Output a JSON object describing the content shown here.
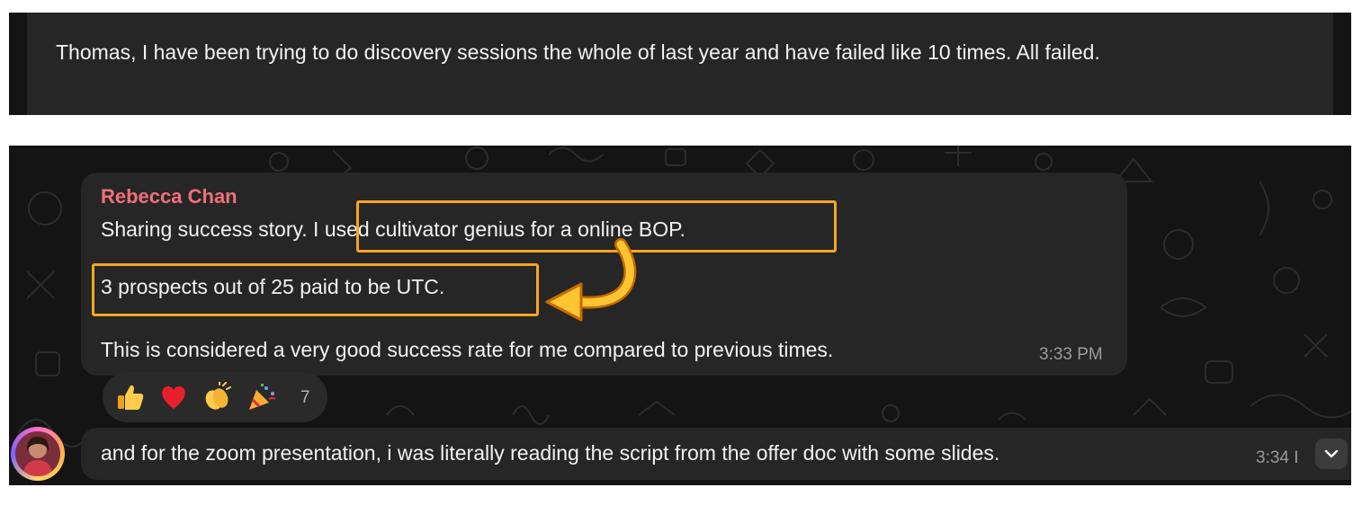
{
  "messages": {
    "thomas_reply": "Thomas, I have been trying to do discovery sessions the whole of last year and have failed like 10 times. All failed.",
    "rebecca": {
      "sender": "Rebecca Chan",
      "line1": "Sharing success story. I used cultivator genius for a online BOP.",
      "line2": "3 prospects out of 25 paid to be UTC.",
      "line3": "This is considered a very good success rate for me compared to previous times.",
      "time": "3:33 PM"
    },
    "reactions": {
      "items": [
        "thumbs-up",
        "red-heart",
        "clapping-hands",
        "party-popper"
      ],
      "count": "7"
    },
    "zoom": {
      "text": "and for the zoom presentation, i was literally reading the script from the offer doc with some slides.",
      "time": "3:34 I"
    }
  },
  "colors": {
    "sender_name": "#f0707a",
    "highlight": "#f5a623",
    "bubble": "#262626",
    "background": "#141414"
  }
}
